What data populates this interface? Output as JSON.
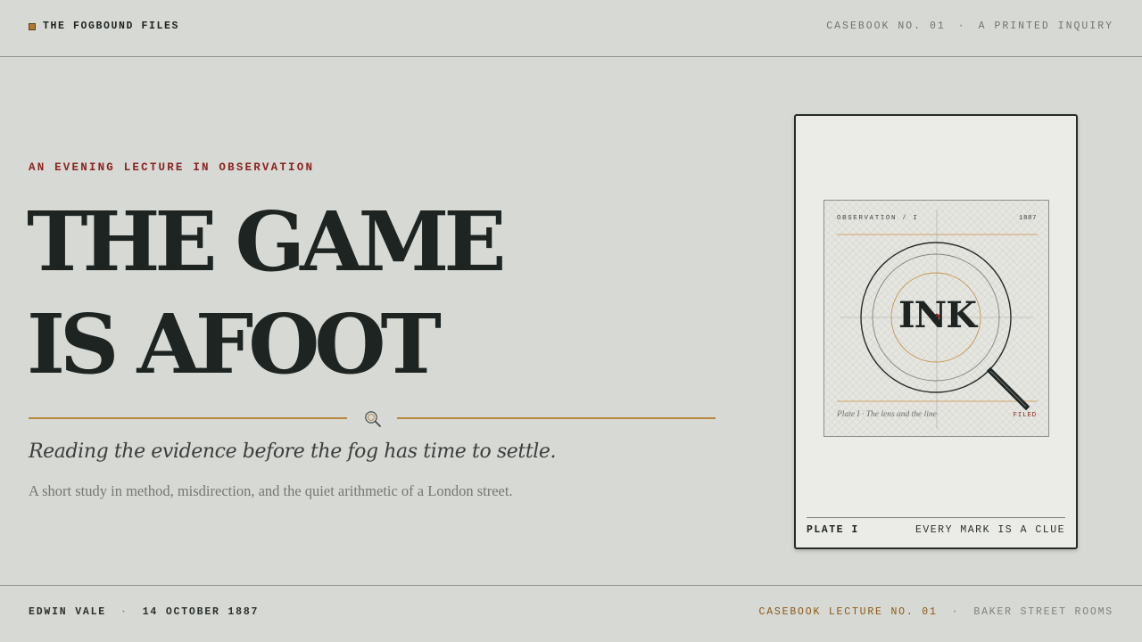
{
  "header": {
    "brand": "THE FOGBOUND FILES",
    "casebook": "CASEBOOK NO. 01",
    "separator": "·",
    "tagline": "A PRINTED INQUIRY"
  },
  "hero": {
    "eyebrow": "AN EVENING LECTURE IN OBSERVATION",
    "title_line1": "THE GAME",
    "title_line2": "IS AFOOT",
    "subtitle": "Reading the evidence before the fog has time to settle.",
    "lede": "A short study in method, misdirection, and the quiet arithmetic of a London street."
  },
  "plate": {
    "top_label": "OBSERVATION / I",
    "year": "1887",
    "word": "INK",
    "caption": "Plate I · The lens and the line",
    "stamp": "FILED",
    "footer_label": "PLATE I",
    "footer_motto": "EVERY MARK IS A CLUE"
  },
  "footer": {
    "author": "EDWIN VALE",
    "separator": "·",
    "date": "14 OCTOBER 1887",
    "lecture": "CASEBOOK LECTURE NO. 01",
    "venue": "BAKER STREET ROOMS"
  },
  "colors": {
    "background": "#d7d9d4",
    "ink": "#1d2422",
    "accent_red": "#8a2420",
    "accent_gold": "#b7873c"
  },
  "icons": {
    "brand": "square-mark-icon",
    "divider": "magnifying-glass-icon",
    "plate": "magnifying-glass-icon"
  }
}
